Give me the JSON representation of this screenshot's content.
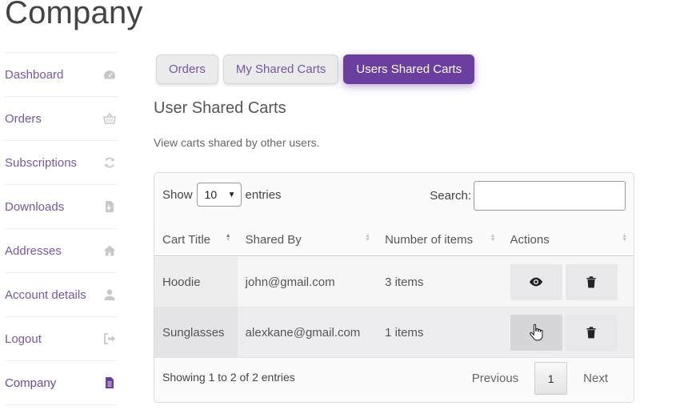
{
  "page": {
    "title": "Company"
  },
  "sidebar": {
    "items": [
      {
        "label": "Dashboard",
        "icon": "dashboard-icon"
      },
      {
        "label": "Orders",
        "icon": "basket-icon"
      },
      {
        "label": "Subscriptions",
        "icon": "refresh-icon"
      },
      {
        "label": "Downloads",
        "icon": "file-download-icon"
      },
      {
        "label": "Addresses",
        "icon": "home-icon"
      },
      {
        "label": "Account details",
        "icon": "user-icon"
      },
      {
        "label": "Logout",
        "icon": "sign-out-icon"
      },
      {
        "label": "Company",
        "icon": "document-icon",
        "active": true
      }
    ]
  },
  "tabs": [
    {
      "label": "Orders"
    },
    {
      "label": "My Shared Carts"
    },
    {
      "label": "Users Shared Carts",
      "active": true
    }
  ],
  "section": {
    "title": "User Shared Carts",
    "description": "View carts shared by other users."
  },
  "table": {
    "show_label": "Show",
    "entries_label": "entries",
    "page_size": "10",
    "search_label": "Search:",
    "search_value": "",
    "columns": [
      "Cart Title",
      "Shared By",
      "Number of items",
      "Actions"
    ],
    "rows": [
      {
        "title": "Hoodie",
        "shared_by": "john@gmail.com",
        "items": "3 items"
      },
      {
        "title": "Sunglasses",
        "shared_by": "alexkane@gmail.com",
        "items": "1 items"
      }
    ],
    "info": "Showing 1 to 2 of 2 entries",
    "pagination": {
      "previous": "Previous",
      "current": "1",
      "next": "Next"
    }
  },
  "colors": {
    "accent": "#6b3fa0",
    "link": "#7557a6"
  }
}
